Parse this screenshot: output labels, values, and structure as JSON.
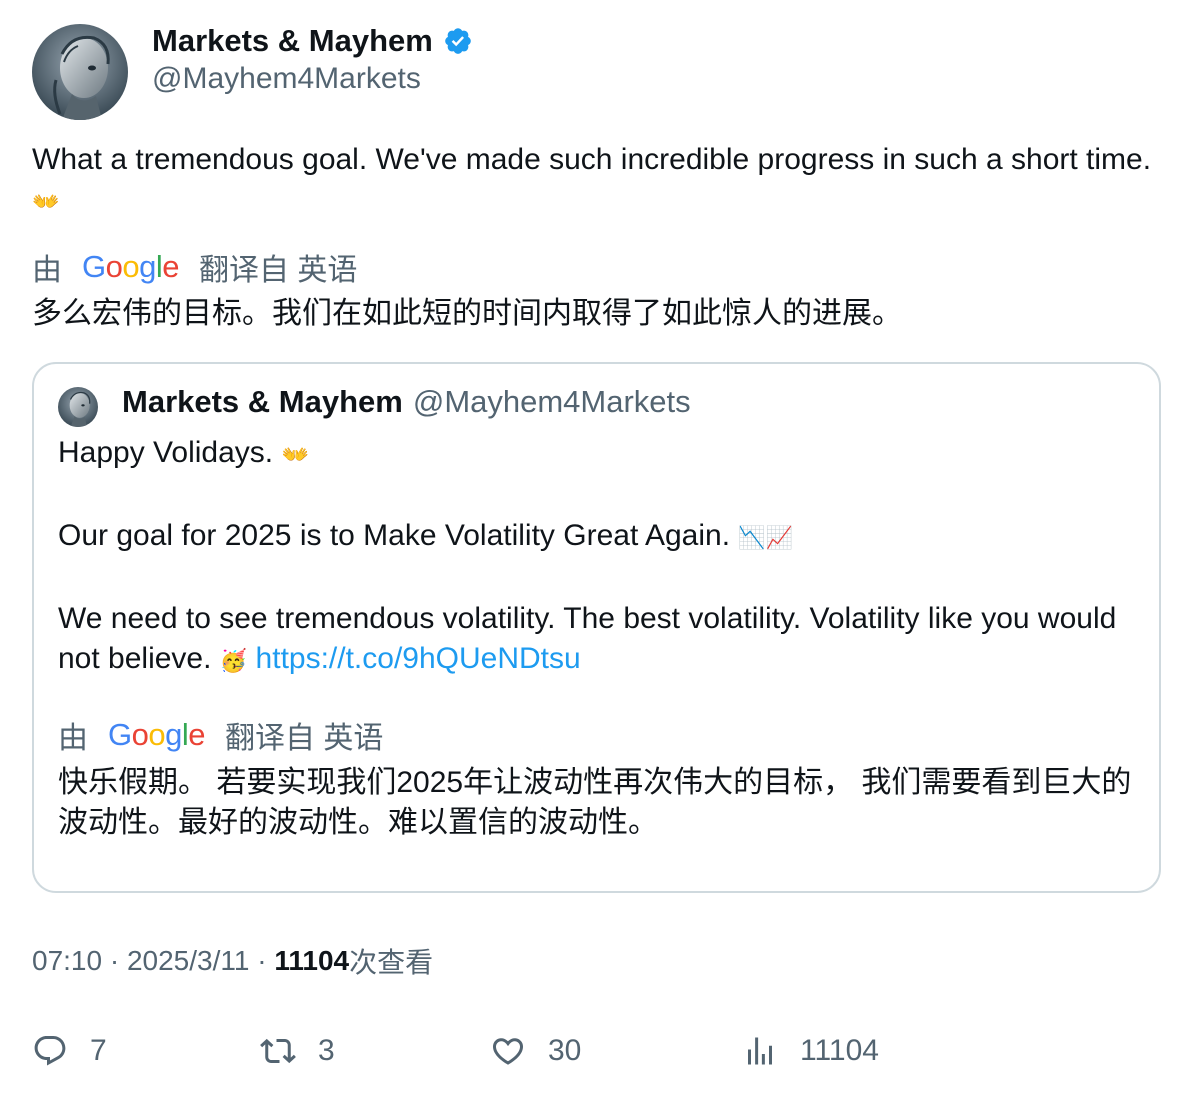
{
  "author": {
    "display_name": "Markets & Mayhem",
    "handle": "@Mayhem4Markets",
    "verified": true
  },
  "tweet": {
    "text": "What a tremendous goal. We've made such incredible progress in such a short time.",
    "emoji": "👐",
    "translation_prefix": "由",
    "translation_engine": "Google",
    "translation_suffix": "翻译自 英语",
    "translation": "多么宏伟的目标。我们在如此短的时间内取得了如此惊人的进展。"
  },
  "quoted": {
    "display_name": "Markets & Mayhem",
    "handle": "@Mayhem4Markets",
    "line1": "Happy Volidays.",
    "line1_emoji": "👐",
    "line2": "Our goal for 2025 is to Make Volatility Great Again.",
    "line2_emoji": "📉📈",
    "line3": "We need to see tremendous volatility. The best volatility. Volatility like you would not believe.",
    "line3_emoji": "🥳",
    "link": "https://t.co/9hQUeNDtsu",
    "translation_prefix": "由",
    "translation_engine": "Google",
    "translation_suffix": "翻译自 英语",
    "translation": "快乐假期。 若要实现我们2025年让波动性再次伟大的目标， 我们需要看到巨大的波动性。最好的波动性。难以置信的波动性。"
  },
  "meta": {
    "time": "07:10",
    "sep1": "·",
    "date": "2025/3/11",
    "sep2": "·",
    "views": "11104",
    "views_label": "次查看"
  },
  "actions": {
    "replies": "7",
    "retweets": "3",
    "likes": "30",
    "views": "11104"
  },
  "colors": {
    "text": "#0f1419",
    "secondary": "#536471",
    "link": "#1d9bf0",
    "verified": "#1d9bf0",
    "border": "#cfd9de"
  }
}
